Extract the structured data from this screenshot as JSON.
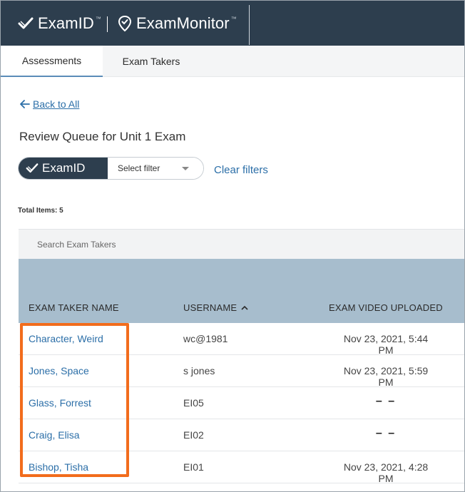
{
  "header": {
    "brand_examid": "ExamID",
    "brand_exammonitor": "ExamMonitor",
    "trademark": "™"
  },
  "tabs": [
    {
      "label": "Assessments",
      "active": true
    },
    {
      "label": "Exam Takers",
      "active": false
    }
  ],
  "back_link": "Back to All",
  "page_title": "Review Queue for Unit 1 Exam",
  "filter": {
    "pill_label": "ExamID",
    "select_value": "Select filter",
    "clear_label": "Clear filters"
  },
  "total_items": "Total Items: 5",
  "search": {
    "placeholder": "Search Exam Takers"
  },
  "table": {
    "columns": {
      "name": "EXAM TAKER NAME",
      "username": "USERNAME",
      "video": "EXAM VIDEO UPLOADED"
    },
    "rows": [
      {
        "name": "Character, Weird",
        "username": "wc@1981",
        "video": "Nov 23, 2021, 5:44 PM"
      },
      {
        "name": "Jones, Space",
        "username": "s jones",
        "video": "Nov 23, 2021, 5:59 PM"
      },
      {
        "name": "Glass, Forrest",
        "username": "EI05",
        "video": "– –"
      },
      {
        "name": "Craig, Elisa",
        "username": "EI02",
        "video": "– –"
      },
      {
        "name": "Bishop, Tisha",
        "username": "EI01",
        "video": "Nov 23, 2021, 4:28 PM"
      }
    ]
  },
  "colors": {
    "header_bg": "#2d3e4e",
    "table_header_bg": "#a7bdcd",
    "link": "#2c6fa8",
    "highlight": "#f26c1c"
  }
}
